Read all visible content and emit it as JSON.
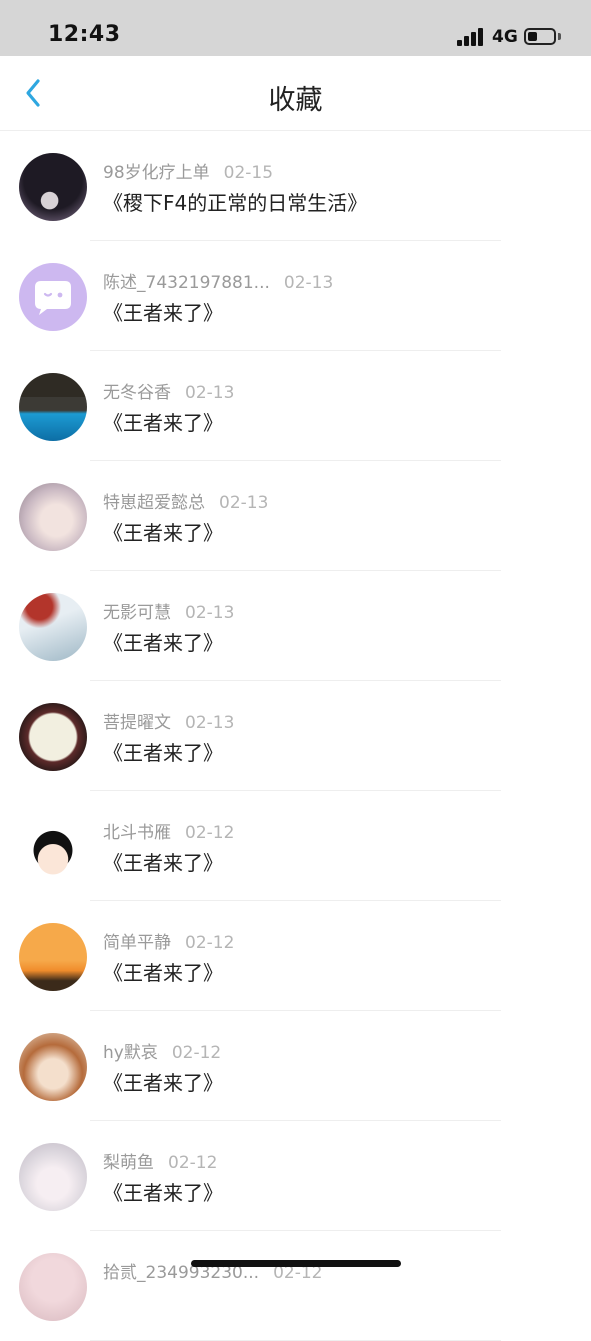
{
  "status_bar": {
    "time": "12:43",
    "network": "4G",
    "battery_level": 0.35
  },
  "header": {
    "title": "收藏",
    "back_icon": "chevron-left-icon",
    "accent": "#2ea7e0"
  },
  "favorites": [
    {
      "user": "98岁化疗上单",
      "date": "02-15",
      "title": "《稷下F4的正常的日常生活》",
      "avatar_style": "dark-hair"
    },
    {
      "user": "陈述_7432197881...",
      "date": "02-13",
      "title": "《王者来了》",
      "avatar_style": "lilac-bubble"
    },
    {
      "user": "无冬谷香",
      "date": "02-13",
      "title": "《王者来了》",
      "avatar_style": "ocean"
    },
    {
      "user": "特崽超爱懿总",
      "date": "02-13",
      "title": "《王者来了》",
      "avatar_style": "pale-portrait"
    },
    {
      "user": "无影可慧",
      "date": "02-13",
      "title": "《王者来了》",
      "avatar_style": "red-shoulder"
    },
    {
      "user": "菩提曜文",
      "date": "02-13",
      "title": "《王者来了》",
      "avatar_style": "dark-plate"
    },
    {
      "user": "北斗书雁",
      "date": "02-12",
      "title": "《王者来了》",
      "avatar_style": "cartoon-face"
    },
    {
      "user": "简单平静",
      "date": "02-12",
      "title": "《王者来了》",
      "avatar_style": "sunset"
    },
    {
      "user": "hy默哀",
      "date": "02-12",
      "title": "《王者来了》",
      "avatar_style": "brown-hair"
    },
    {
      "user": "梨萌鱼",
      "date": "02-12",
      "title": "《王者来了》",
      "avatar_style": "white-hair"
    },
    {
      "user": "拾贰_234993230...",
      "date": "02-12",
      "title": "",
      "avatar_style": "pink-partial"
    }
  ]
}
